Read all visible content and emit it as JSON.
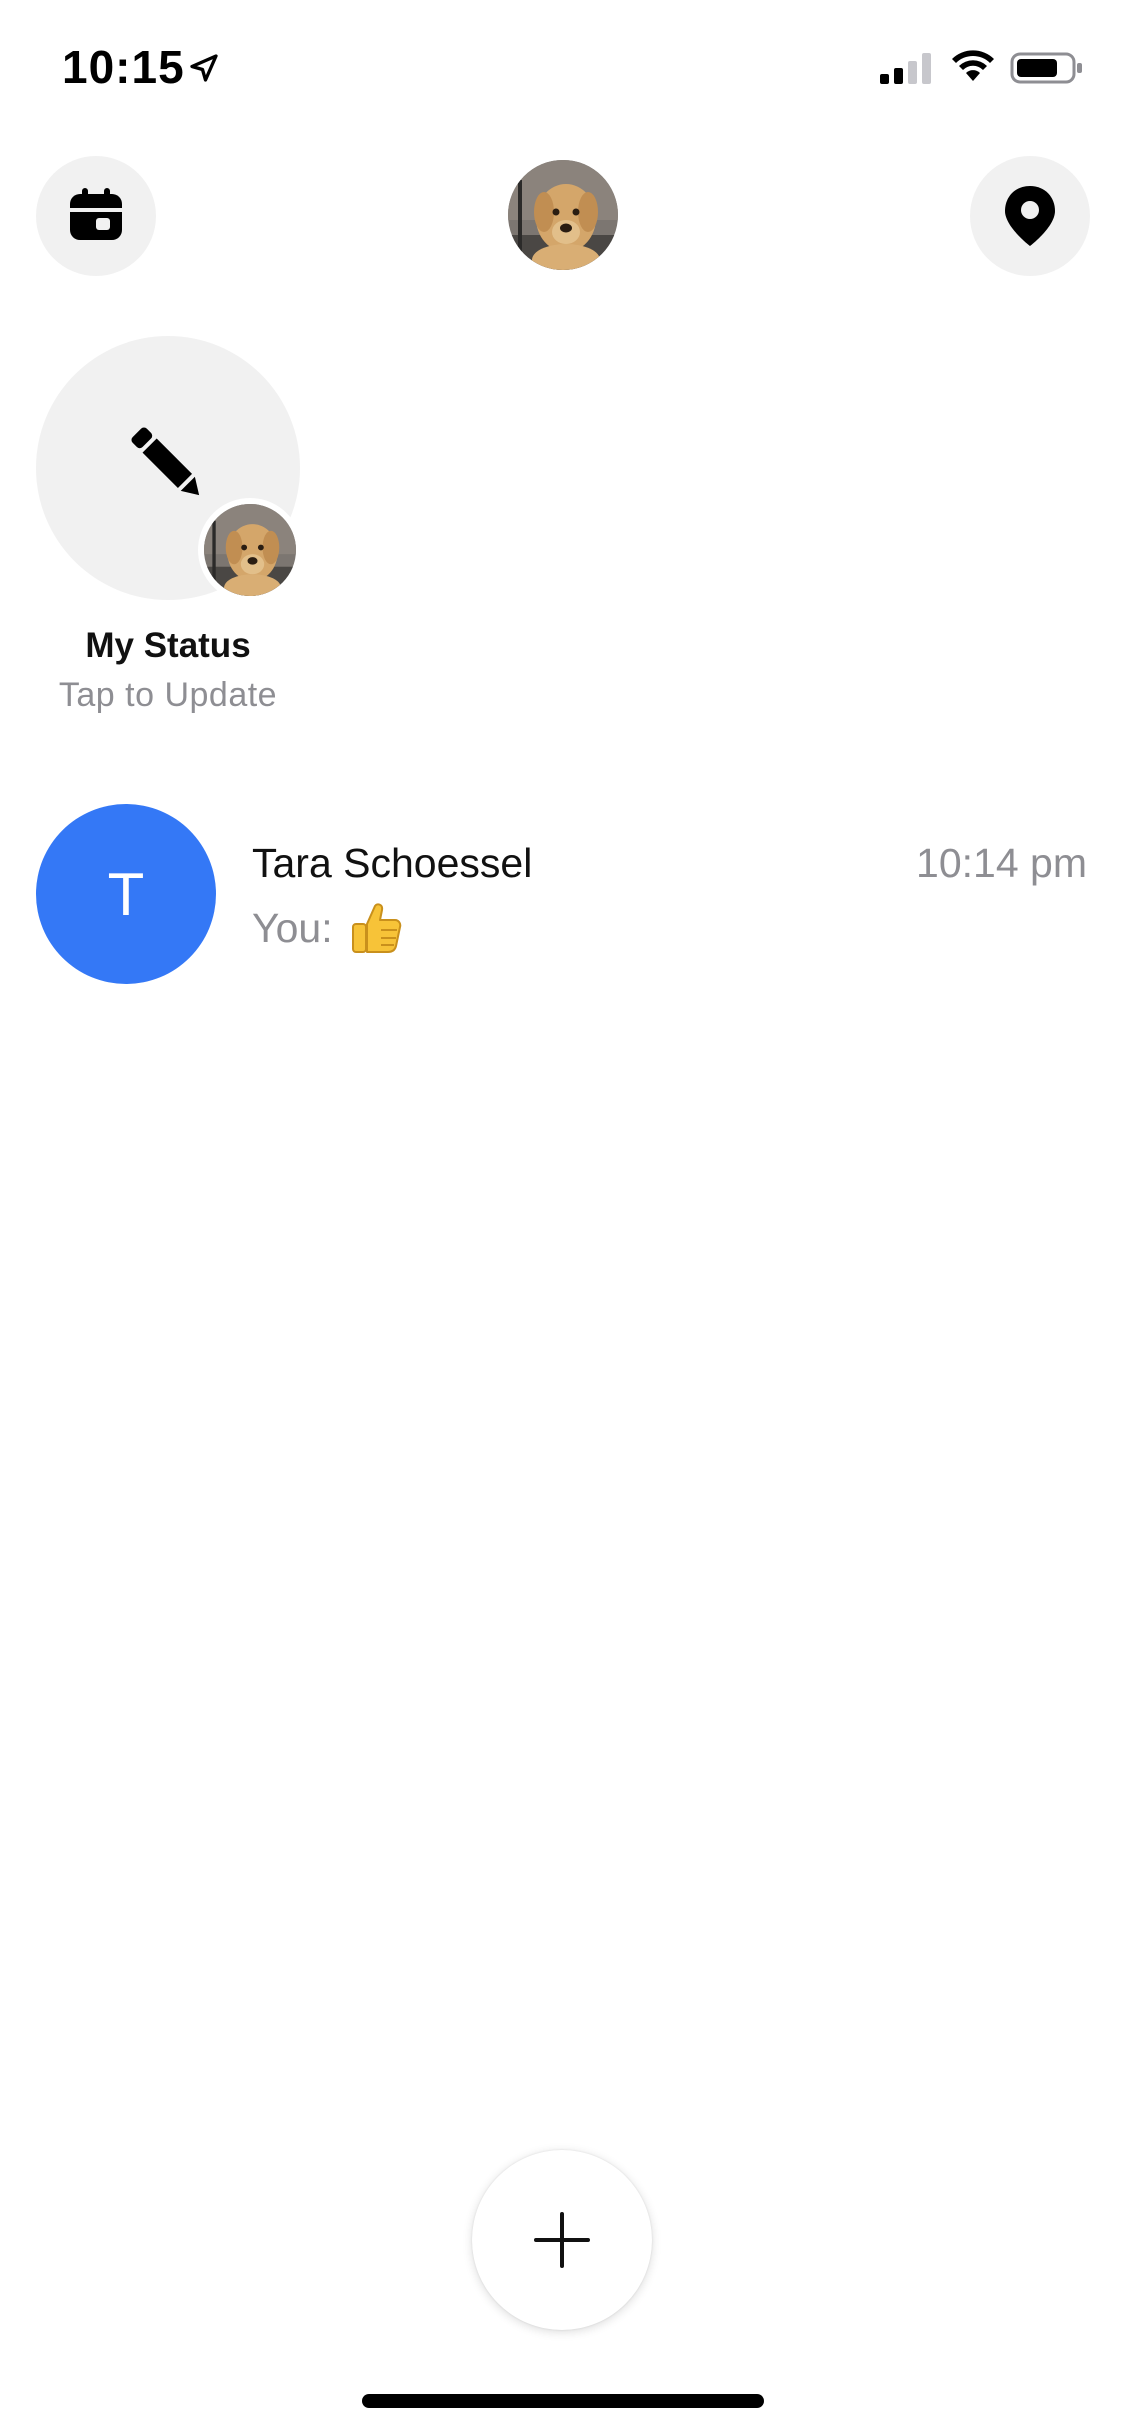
{
  "status_bar": {
    "time": "10:15",
    "icons": [
      "location-arrow-icon",
      "signal-icon",
      "wifi-icon",
      "battery-icon"
    ]
  },
  "header": {
    "left_icon": "calendar-icon",
    "center_icon": "profile-avatar",
    "right_icon": "map-pin-icon"
  },
  "my_status": {
    "title": "My Status",
    "subtitle": "Tap to Update",
    "icon": "pencil-icon"
  },
  "conversations": [
    {
      "initial": "T",
      "name": "Tara Schoessel",
      "time": "10:14 pm",
      "preview_prefix": "You:",
      "preview_emoji": "thumbs-up",
      "avatar_color": "#3478f6"
    }
  ],
  "fab": {
    "icon": "plus-icon"
  },
  "colors": {
    "accent": "#3478f6",
    "muted_text": "#8e8e93",
    "button_bg": "#f1f1f1"
  }
}
